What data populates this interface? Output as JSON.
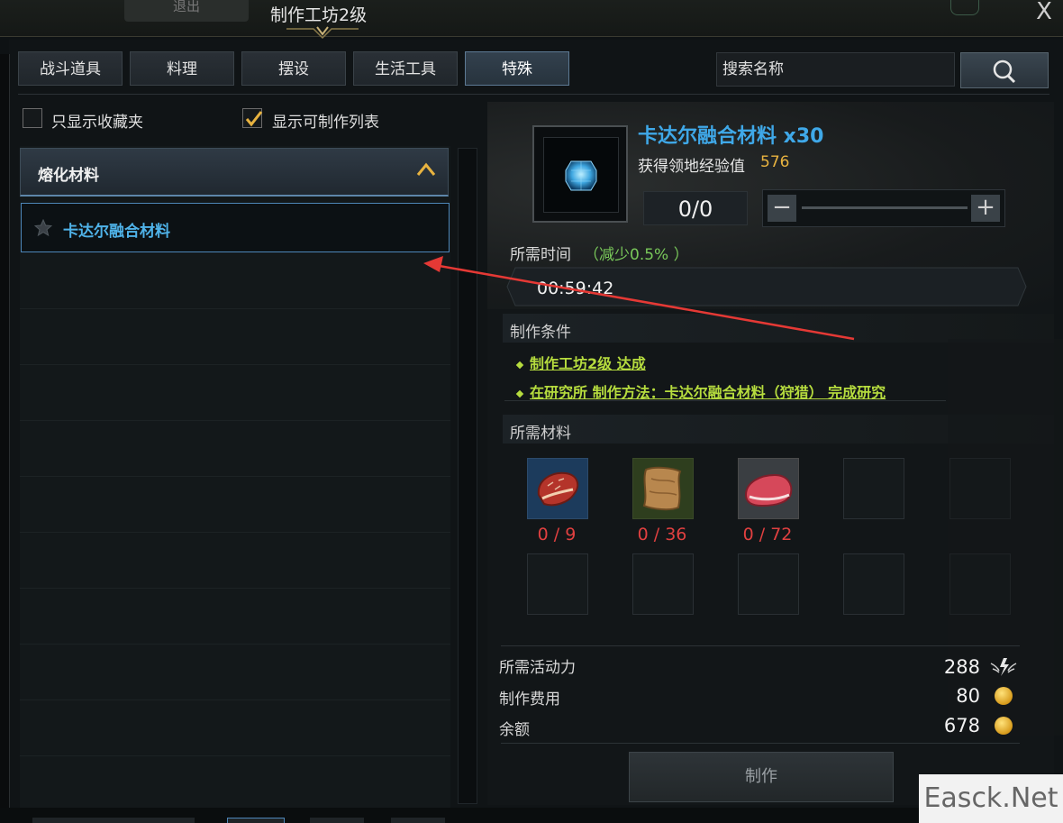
{
  "window": {
    "title": "制作工坊2级",
    "exit_label": "退出",
    "close_label": "X"
  },
  "tabs": [
    {
      "label": "战斗道具"
    },
    {
      "label": "料理"
    },
    {
      "label": "摆设"
    },
    {
      "label": "生活工具"
    },
    {
      "label": "特殊",
      "active": true
    }
  ],
  "search": {
    "placeholder": "搜索名称"
  },
  "filters": {
    "favorites_only": {
      "label": "只显示收藏夹",
      "checked": false
    },
    "craftable_only": {
      "label": "显示可制作列表",
      "checked": true
    }
  },
  "list": {
    "category": "熔化材料",
    "items": [
      {
        "label": "卡达尔融合材料",
        "selected": true
      }
    ]
  },
  "detail": {
    "item_name": "卡达尔融合材料 x30",
    "exp_label": "获得领地经验值",
    "exp_value": "576",
    "quantity": "0/0",
    "time_label": "所需时间",
    "time_reduction": "（减少0.5% ）",
    "time_value": "00:59:42",
    "conditions_title": "制作条件",
    "conditions": [
      "制作工坊2级 达成",
      "在研究所 制作方法：卡达尔融合材料（狩猎） 完成研究"
    ],
    "materials_title": "所需材料",
    "materials": [
      {
        "icon": "red-meat-steak-icon",
        "count": "0 / 9"
      },
      {
        "icon": "leather-hide-icon",
        "count": "0 / 36"
      },
      {
        "icon": "raw-meat-icon",
        "count": "0 / 72"
      }
    ],
    "costs": [
      {
        "label": "所需活动力",
        "value": "288",
        "icon": "energy-wings-icon"
      },
      {
        "label": "制作费用",
        "value": "80",
        "icon": "gold-coin-icon"
      },
      {
        "label": "余额",
        "value": "678",
        "icon": "gold-coin-icon"
      }
    ],
    "craft_label": "制作"
  },
  "watermark": "Easck.Net",
  "colors": {
    "accent_blue": "#3fa8e8",
    "condition_green": "#b6dc3e",
    "missing_red": "#e04040",
    "exp_gold": "#e8b340",
    "annotation_arrow": "#e53935"
  }
}
